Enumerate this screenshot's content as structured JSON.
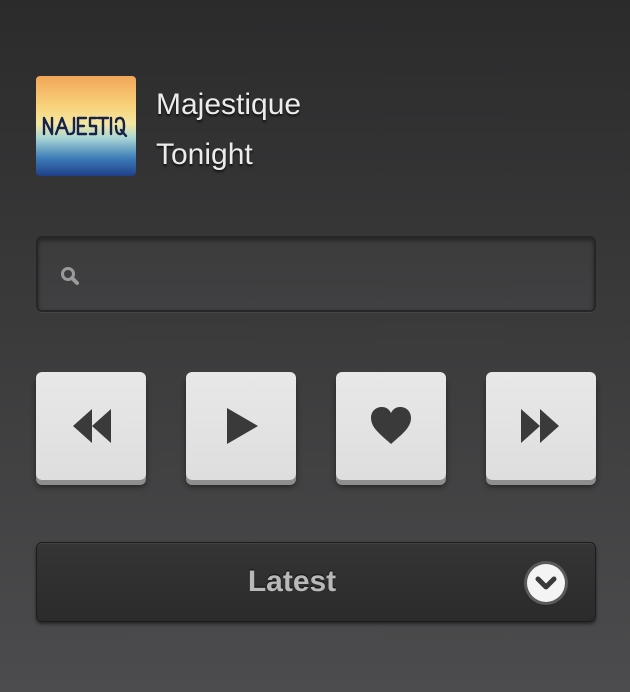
{
  "now_playing": {
    "artist": "Majestique",
    "title": "Tonight",
    "album_art_text": "MAJESTIQUE"
  },
  "search": {
    "value": "",
    "placeholder": "",
    "icon": "search-icon"
  },
  "controls": [
    {
      "name": "rewind",
      "icon": "rewind-icon"
    },
    {
      "name": "play",
      "icon": "play-icon"
    },
    {
      "name": "favorite",
      "icon": "heart-icon"
    },
    {
      "name": "fast-forward",
      "icon": "fast-forward-icon"
    }
  ],
  "sort_dropdown": {
    "selected": "Latest",
    "icon": "chevron-down-icon"
  },
  "colors": {
    "background": "#3a3a3b",
    "button_face": "#e2e2e2",
    "icon": "#3a3a3a",
    "text": "#ececec"
  }
}
